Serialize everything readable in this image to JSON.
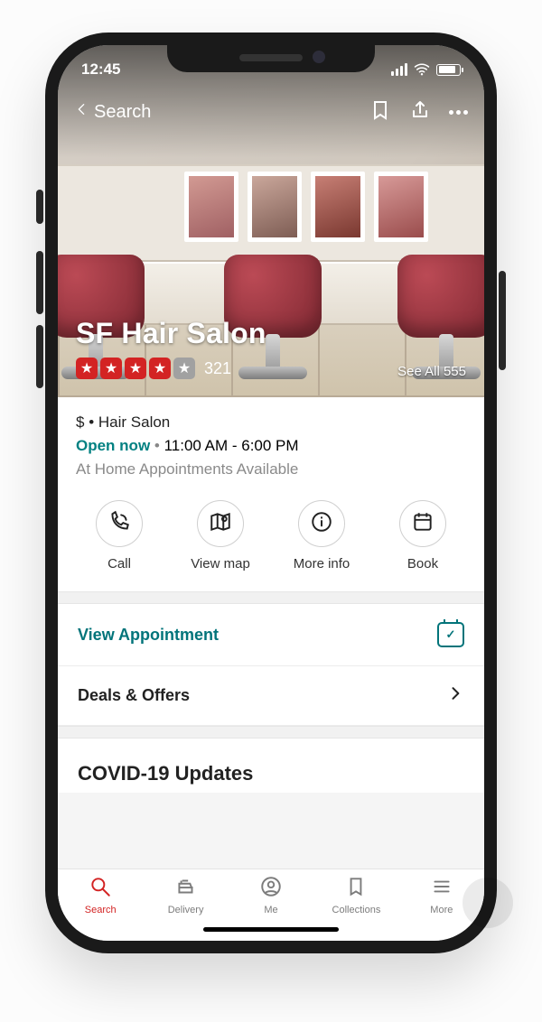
{
  "status": {
    "time": "12:45"
  },
  "nav": {
    "back_label": "Search"
  },
  "hero": {
    "name": "SF Hair Salon",
    "filled_stars": 4,
    "grey_stars": 1,
    "review_count": "321",
    "see_all_label": "See All 555"
  },
  "info": {
    "price": "$",
    "bullet": "•",
    "category": "Hair Salon",
    "open_label": "Open now",
    "hours_sep": " • ",
    "hours": "11:00 AM - 6:00 PM",
    "note": "At Home Appointments Available"
  },
  "actions": {
    "call": "Call",
    "view_map": "View map",
    "more_info": "More info",
    "book": "Book"
  },
  "rows": {
    "view_appointment": "View Appointment",
    "deals": "Deals & Offers"
  },
  "covid": {
    "title": "COVID-19 Updates"
  },
  "tabs": {
    "search": "Search",
    "delivery": "Delivery",
    "me": "Me",
    "collections": "Collections",
    "more": "More"
  }
}
